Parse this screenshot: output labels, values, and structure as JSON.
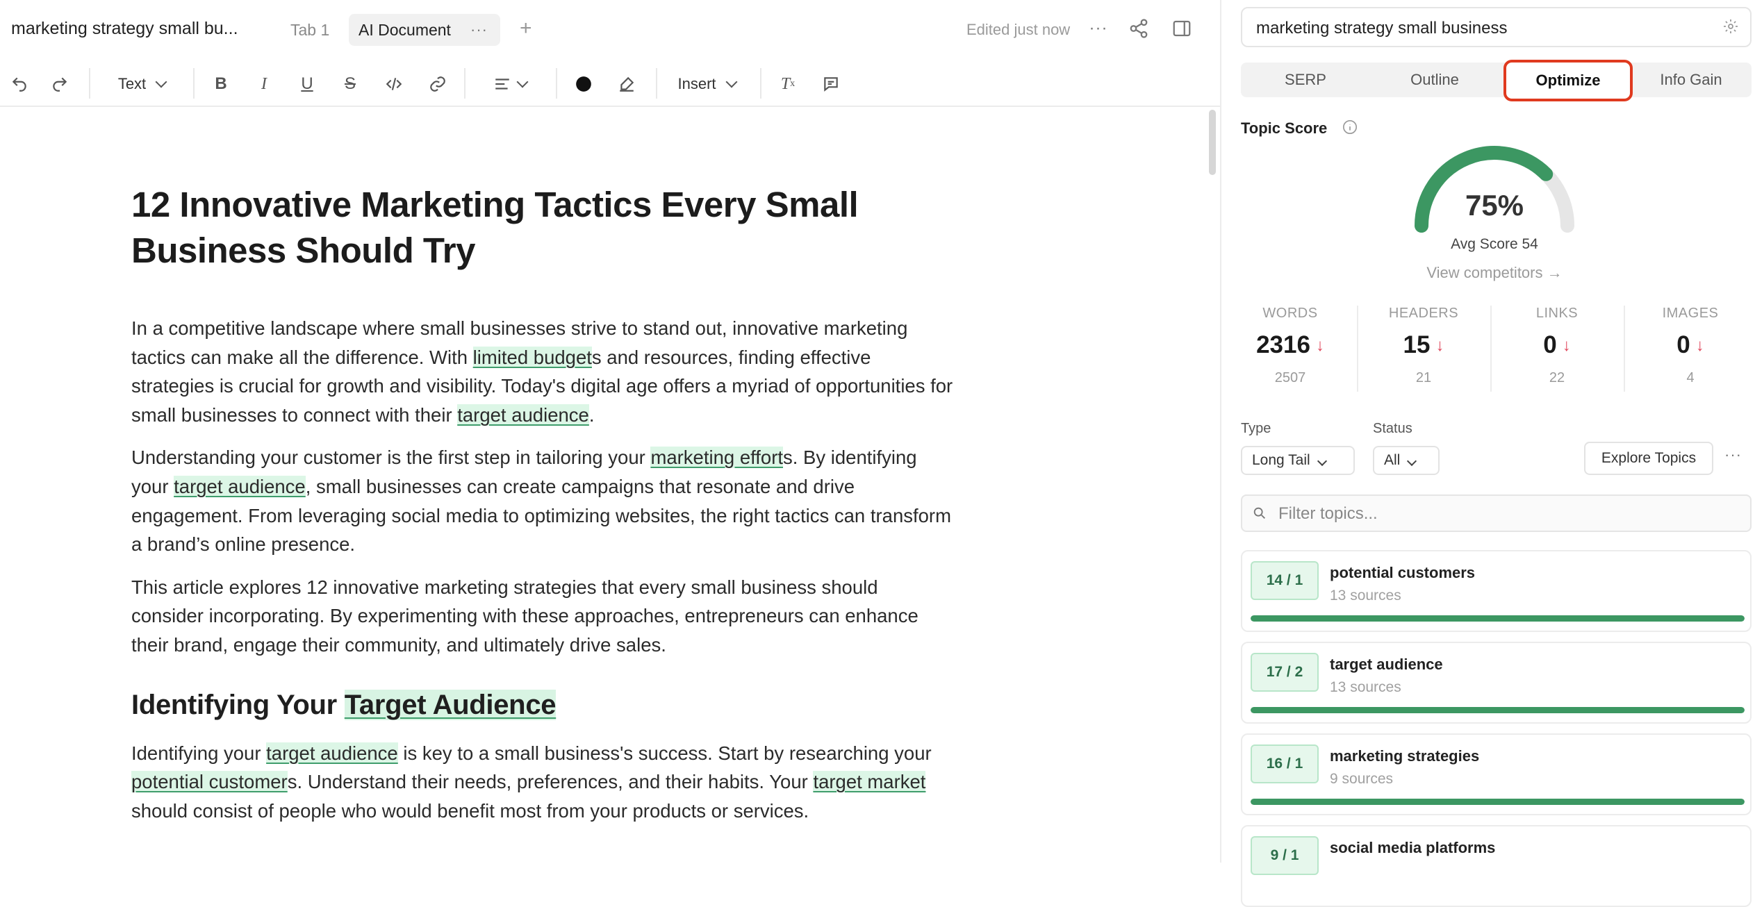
{
  "header": {
    "doc_title": "marketing strategy small bu...",
    "tabs": [
      "Tab 1",
      "AI Document"
    ],
    "tab_menu": "···",
    "add_tab": "+",
    "edited_status": "Edited just now",
    "more": "···"
  },
  "toolbar": {
    "text_style": "Text",
    "insert": "Insert",
    "icons": [
      "undo-icon",
      "redo-icon",
      "bold-icon",
      "italic-icon",
      "underline-icon",
      "strikethrough-icon",
      "code-icon",
      "link-icon",
      "align-icon",
      "text-color-icon",
      "highlight-icon",
      "clear-format-icon",
      "comment-icon"
    ],
    "text_color": "#111111"
  },
  "document": {
    "title": "12 Innovative Marketing Tactics Every Small Business Should Try",
    "p1": {
      "a": "In a competitive landscape where small businesses strive to stand out, innovative marketing tactics can make all the difference. With ",
      "h1": "limited budget",
      "b": "s and resources, finding effective strategies is crucial for growth and visibility. Today's digital age offers a myriad of opportunities for small businesses to connect with their ",
      "h2": "target audience",
      "c": "."
    },
    "p2": {
      "a": "Understanding your customer is the first step in tailoring your ",
      "h1": "marketing effort",
      "b": "s. By identifying your ",
      "h2": "target audience",
      "c": ", small businesses can create campaigns that resonate and drive engagement. From leveraging social media to optimizing websites, the right tactics can transform a brand’s online presence."
    },
    "p3": "This article explores 12 innovative marketing strategies that every small business should consider incorporating. By experimenting with these approaches, entrepreneurs can enhance their brand, engage their community, and ultimately drive sales.",
    "h2": {
      "a": "Identifying Your ",
      "h": "Target Audience"
    },
    "p4": {
      "a": "Identifying your ",
      "h1": "target audience",
      "b": " is key to a small business's success. Start by researching your ",
      "h2": "potential customer",
      "c": "s. Understand their needs, preferences, and their habits. Your ",
      "h3": "target market",
      "d": " should consist of people who would benefit most from your products or services."
    },
    "highlight_color": "#dcf6e6"
  },
  "sidebar": {
    "query": "marketing strategy small business",
    "subtabs": [
      "SERP",
      "Outline",
      "Optimize",
      "Info Gain"
    ],
    "active_subtab": "Optimize",
    "topic_score_label": "Topic Score",
    "score": 75,
    "score_text": "75%",
    "avg_score": "Avg Score 54",
    "view_competitors": "View competitors →",
    "stats": [
      {
        "label": "WORDS",
        "value": "2316",
        "avg": "2507",
        "trend": "↓"
      },
      {
        "label": "HEADERS",
        "value": "15",
        "avg": "21",
        "trend": "↓"
      },
      {
        "label": "LINKS",
        "value": "0",
        "avg": "22",
        "trend": "↓"
      },
      {
        "label": "IMAGES",
        "value": "0",
        "avg": "4",
        "trend": "↓"
      }
    ],
    "type_label": "Type",
    "type_value": "Long Tail",
    "status_label": "Status",
    "status_value": "All",
    "explore_button": "Explore Topics",
    "more": "···",
    "filter_placeholder": "Filter topics...",
    "topics": [
      {
        "badge": "14 / 1",
        "name": "potential customers",
        "sources": "13 sources",
        "progress": 1.0
      },
      {
        "badge": "17 / 2",
        "name": "target audience",
        "sources": "13 sources",
        "progress": 1.0
      },
      {
        "badge": "16 / 1",
        "name": "marketing strategies",
        "sources": "9 sources",
        "progress": 1.0
      },
      {
        "badge": "9 / 1",
        "name": "social media platforms",
        "sources": "",
        "progress": 1.0
      }
    ],
    "colors": {
      "accent": "#e03a1f",
      "gauge": "#3c9762",
      "trend_down": "#e0445a"
    }
  }
}
